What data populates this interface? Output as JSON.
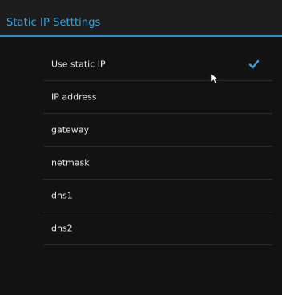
{
  "dialog": {
    "title": "Static IP Setttings"
  },
  "settings": {
    "items": [
      {
        "label": "Use static IP",
        "checked": true
      },
      {
        "label": "IP address"
      },
      {
        "label": "gateway"
      },
      {
        "label": "netmask"
      },
      {
        "label": "dns1"
      },
      {
        "label": "dns2"
      }
    ]
  },
  "colors": {
    "accent": "#35a3e0",
    "background": "#121212",
    "divider": "#2a2a2a",
    "text": "#e6e6e6"
  },
  "icons": {
    "check": "checkmark-icon",
    "cursor": "mouse-pointer-icon"
  }
}
